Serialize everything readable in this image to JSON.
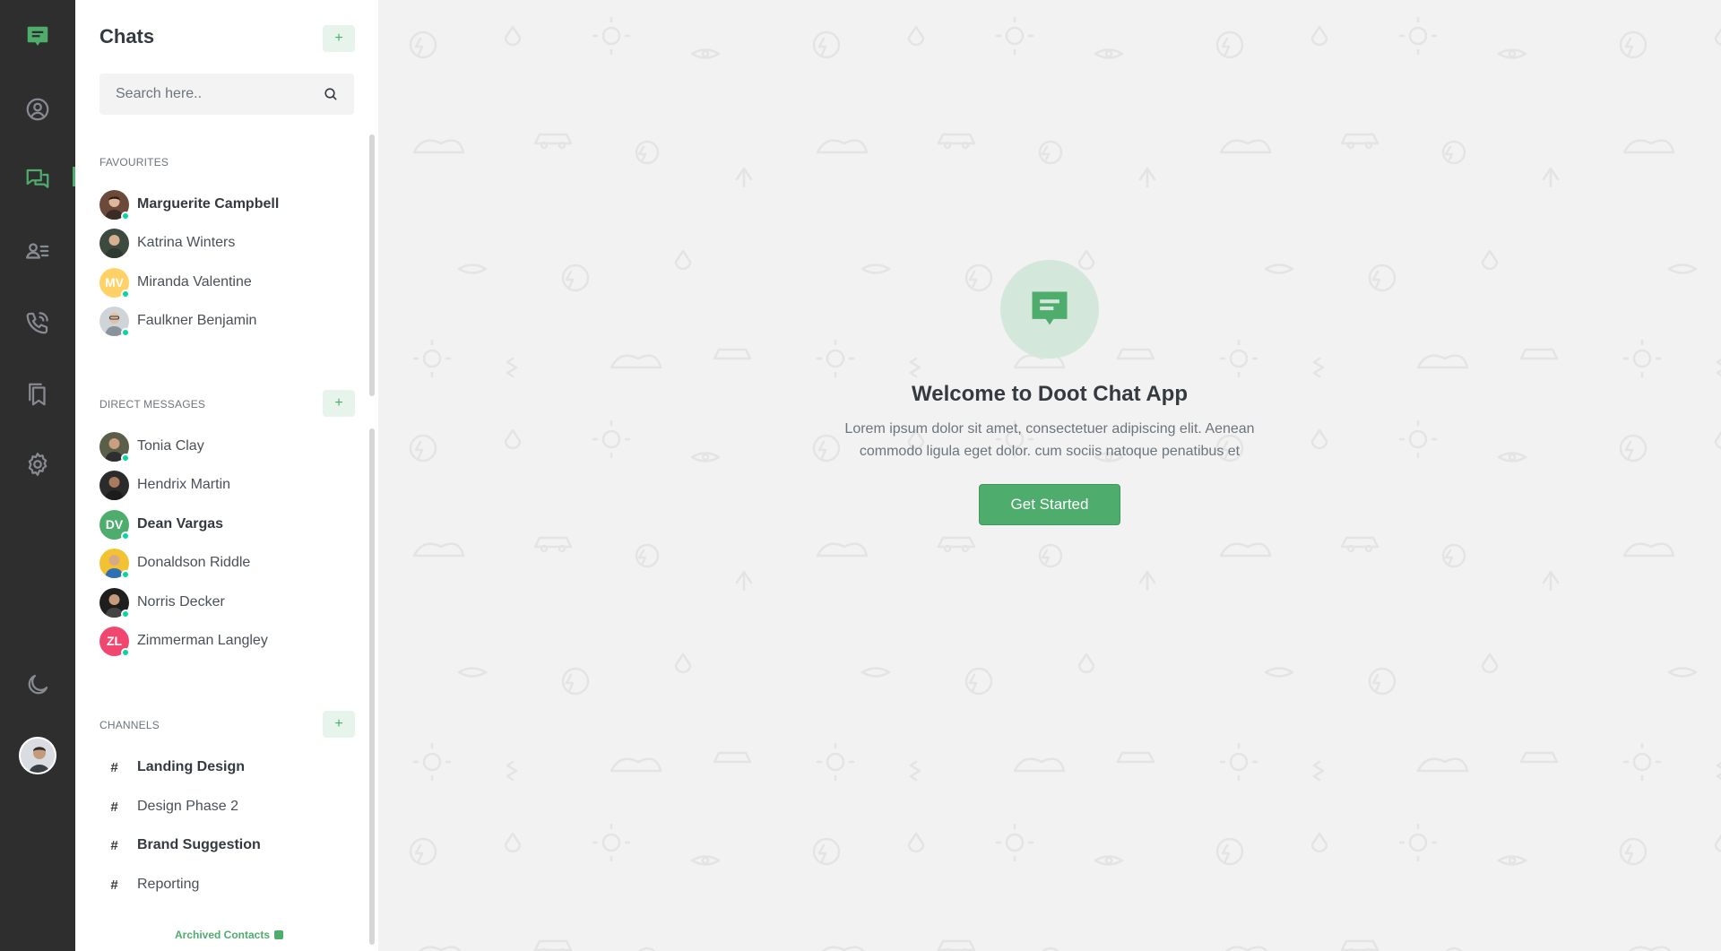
{
  "rail": {
    "items": [
      {
        "icon": "profile-icon"
      },
      {
        "icon": "chats-icon",
        "active": true
      },
      {
        "icon": "contacts-icon"
      },
      {
        "icon": "calls-icon"
      },
      {
        "icon": "bookmark-icon"
      },
      {
        "icon": "settings-icon"
      }
    ],
    "bottom": [
      {
        "icon": "moon-icon"
      }
    ]
  },
  "sidebar": {
    "title": "Chats",
    "search_placeholder": "Search here..",
    "favourites": {
      "label": "Favourites",
      "items": [
        {
          "name": "Marguerite Campbell",
          "bold": true,
          "online": true
        },
        {
          "name": "Katrina Winters",
          "bold": false,
          "online": false
        },
        {
          "name": "Miranda Valentine",
          "initials": "MV",
          "bold": false,
          "online": true
        },
        {
          "name": "Faulkner Benjamin",
          "bold": false,
          "online": true
        }
      ]
    },
    "direct": {
      "label": "Direct Messages",
      "items": [
        {
          "name": "Tonia Clay",
          "bold": false,
          "online": true
        },
        {
          "name": "Hendrix Martin",
          "bold": false,
          "online": false
        },
        {
          "name": "Dean Vargas",
          "initials": "DV",
          "bold": true,
          "online": true
        },
        {
          "name": "Donaldson Riddle",
          "bold": false,
          "online": true
        },
        {
          "name": "Norris Decker",
          "bold": false,
          "online": true
        },
        {
          "name": "Zimmerman Langley",
          "initials": "ZL",
          "bold": false,
          "online": true
        }
      ]
    },
    "channels": {
      "label": "Channels",
      "items": [
        {
          "name": "Landing Design",
          "bold": true
        },
        {
          "name": "Design Phase 2",
          "bold": false
        },
        {
          "name": "Brand Suggestion",
          "bold": true
        },
        {
          "name": "Reporting",
          "bold": false
        }
      ]
    },
    "archived_label": "Archived Contacts"
  },
  "main": {
    "welcome_title": "Welcome to Doot Chat App",
    "welcome_text": "Lorem ipsum dolor sit amet, consectetuer adipiscing elit. Aenean commodo ligula eget dolor. cum sociis natoque penatibus et",
    "get_started_label": "Get Started"
  },
  "colors": {
    "accent": "#4eac6d",
    "rail_bg": "#2e2e2e",
    "online": "#06d6a0"
  }
}
